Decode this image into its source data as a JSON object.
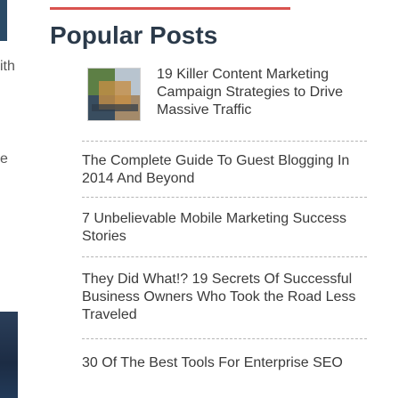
{
  "left_fragments": [
    "ith",
    "e"
  ],
  "widget": {
    "title": "Popular Posts",
    "accent_color": "#d9534f"
  },
  "posts": [
    {
      "title": "19 Killer Content Marketing Campaign Strategies to Drive Massive Traffic",
      "has_thumbnail": true
    },
    {
      "title": "The Complete Guide To Guest Blogging In 2014 And Beyond"
    },
    {
      "title": "7 Unbelievable Mobile Marketing Success Stories"
    },
    {
      "title": "They Did What!? 19 Secrets Of Successful Business Owners Who Took the Road Less Traveled"
    },
    {
      "title": "30 Of The Best Tools For Enterprise SEO"
    }
  ]
}
